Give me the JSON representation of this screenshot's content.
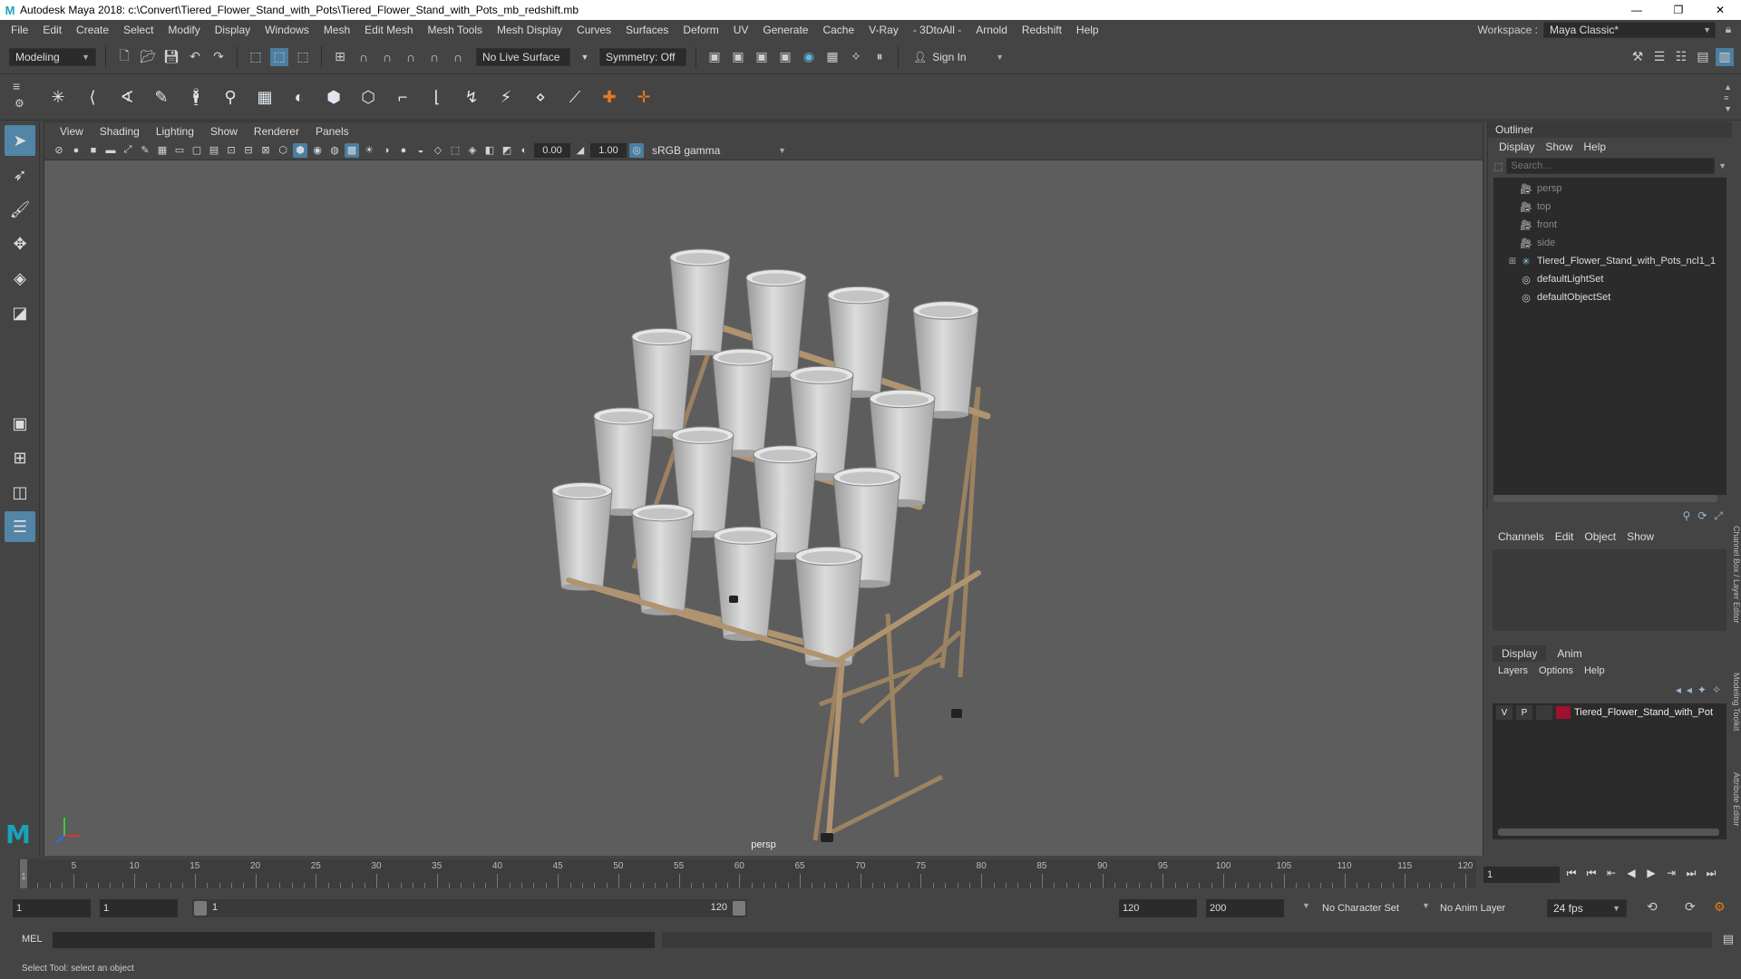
{
  "window": {
    "app_logo": "M",
    "title": "Autodesk Maya 2018: c:\\Convert\\Tiered_Flower_Stand_with_Pots\\Tiered_Flower_Stand_with_Pots_mb_redshift.mb",
    "minimize": "—",
    "maximize": "❐",
    "close": "✕"
  },
  "menubar": {
    "items": [
      "File",
      "Edit",
      "Create",
      "Select",
      "Modify",
      "Display",
      "Windows",
      "Mesh",
      "Edit Mesh",
      "Mesh Tools",
      "Mesh Display",
      "Curves",
      "Surfaces",
      "Deform",
      "UV",
      "Generate",
      "Cache",
      "V-Ray",
      "- 3DtoAll -",
      "Arnold",
      "Redshift",
      "Help"
    ],
    "workspace_label": "Workspace :",
    "workspace_value": "Maya Classic*"
  },
  "statusline": {
    "mode": "Modeling",
    "live_surface": "No Live Surface",
    "symmetry": "Symmetry: Off",
    "sign_in": "Sign In"
  },
  "panel": {
    "menus": [
      "View",
      "Shading",
      "Lighting",
      "Show",
      "Renderer",
      "Panels"
    ],
    "exposure": "0.00",
    "gamma": "1.00",
    "color_space": "sRGB gamma",
    "camera_label": "persp"
  },
  "outliner": {
    "title": "Outliner",
    "menus": [
      "Display",
      "Show",
      "Help"
    ],
    "search_placeholder": "Search...",
    "items": [
      {
        "label": "persp",
        "icon": "camera-icon",
        "dim": true
      },
      {
        "label": "top",
        "icon": "camera-icon",
        "dim": true
      },
      {
        "label": "front",
        "icon": "camera-icon",
        "dim": true
      },
      {
        "label": "side",
        "icon": "camera-icon",
        "dim": true
      },
      {
        "label": "Tiered_Flower_Stand_with_Pots_ncl1_1",
        "icon": "transform-icon",
        "dim": false
      },
      {
        "label": "defaultLightSet",
        "icon": "set-icon",
        "dim": false
      },
      {
        "label": "defaultObjectSet",
        "icon": "set-icon",
        "dim": false
      }
    ]
  },
  "channelbox": {
    "menus": [
      "Channels",
      "Edit",
      "Object",
      "Show"
    ]
  },
  "layereditor": {
    "tabs": [
      "Display",
      "Anim"
    ],
    "menus": [
      "Layers",
      "Options",
      "Help"
    ],
    "layer": {
      "v": "V",
      "p": "P",
      "name": "Tiered_Flower_Stand_with_Pot",
      "color": "#a01030"
    }
  },
  "sidetabs": [
    "Channel Box / Layer Editor",
    "Modeling Toolkit",
    "Attribute Editor"
  ],
  "timeline": {
    "ticks": [
      5,
      10,
      15,
      20,
      25,
      30,
      35,
      40,
      45,
      50,
      55,
      60,
      65,
      70,
      75,
      80,
      85,
      90,
      95,
      100,
      105,
      110,
      115,
      120
    ],
    "start_label": "1",
    "current_frame": "1"
  },
  "range": {
    "start": "1",
    "playback_start": "1",
    "bar_start": "1",
    "bar_end": "120",
    "playback_end": "120",
    "end": "200",
    "character_set": "No Character Set",
    "anim_layer": "No Anim Layer",
    "fps": "24 fps"
  },
  "cmdline": {
    "label": "MEL"
  },
  "helpline": {
    "text": "Select Tool: select an object"
  }
}
